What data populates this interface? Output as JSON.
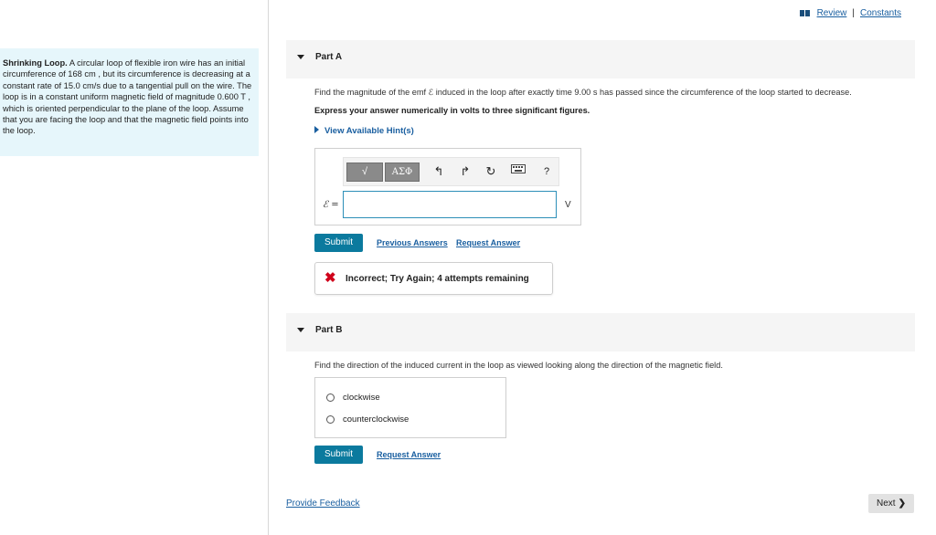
{
  "header": {
    "review_link": "Review",
    "separator": "|",
    "constants_link": "Constants"
  },
  "problem": {
    "title": "Shrinking Loop.",
    "body": "A circular loop of flexible iron wire has an initial circumference of 168 cm , but its circumference is decreasing at a constant rate of 15.0 cm/s due to a tangential pull on the wire. The loop is in a constant uniform magnetic field of magnitude 0.600 T , which is oriented perpendicular to the plane of the loop. Assume that you are facing the loop and that the magnetic field points into the loop."
  },
  "part_a": {
    "title": "Part A",
    "question": "Find the magnitude of the emf ℰ induced in the loop after exactly time 9.00 s has passed since the circumference of the loop started to decrease.",
    "instruction": "Express your answer numerically in volts to three significant figures.",
    "hint_link": "View Available Hint(s)",
    "toolbar": {
      "templates_button": "√",
      "greek_button": "ΑΣΦ",
      "undo_icon": "undo-icon",
      "redo_icon": "redo-icon",
      "reset_icon": "reset-icon",
      "keyboard_icon": "keyboard-icon",
      "help_label": "?"
    },
    "input_label": "ℰ =",
    "input_value": "",
    "unit": "V",
    "submit_label": "Submit",
    "previous_answers_link": "Previous Answers",
    "request_answer_link": "Request Answer",
    "feedback": {
      "icon": "x-icon",
      "message": "Incorrect; Try Again; 4 attempts remaining",
      "color": "#d0021b"
    }
  },
  "part_b": {
    "title": "Part B",
    "question": "Find the direction of the induced current in the loop as viewed looking along the direction of the magnetic field.",
    "options": [
      "clockwise",
      "counterclockwise"
    ],
    "selected": null,
    "submit_label": "Submit",
    "request_answer_link": "Request Answer"
  },
  "footer": {
    "provide_feedback": "Provide Feedback",
    "next_label": "Next"
  },
  "colors": {
    "accent": "#0b7a9e",
    "link": "#1a5fa0",
    "problem_bg": "#e6f6fb",
    "error": "#d0021b"
  }
}
